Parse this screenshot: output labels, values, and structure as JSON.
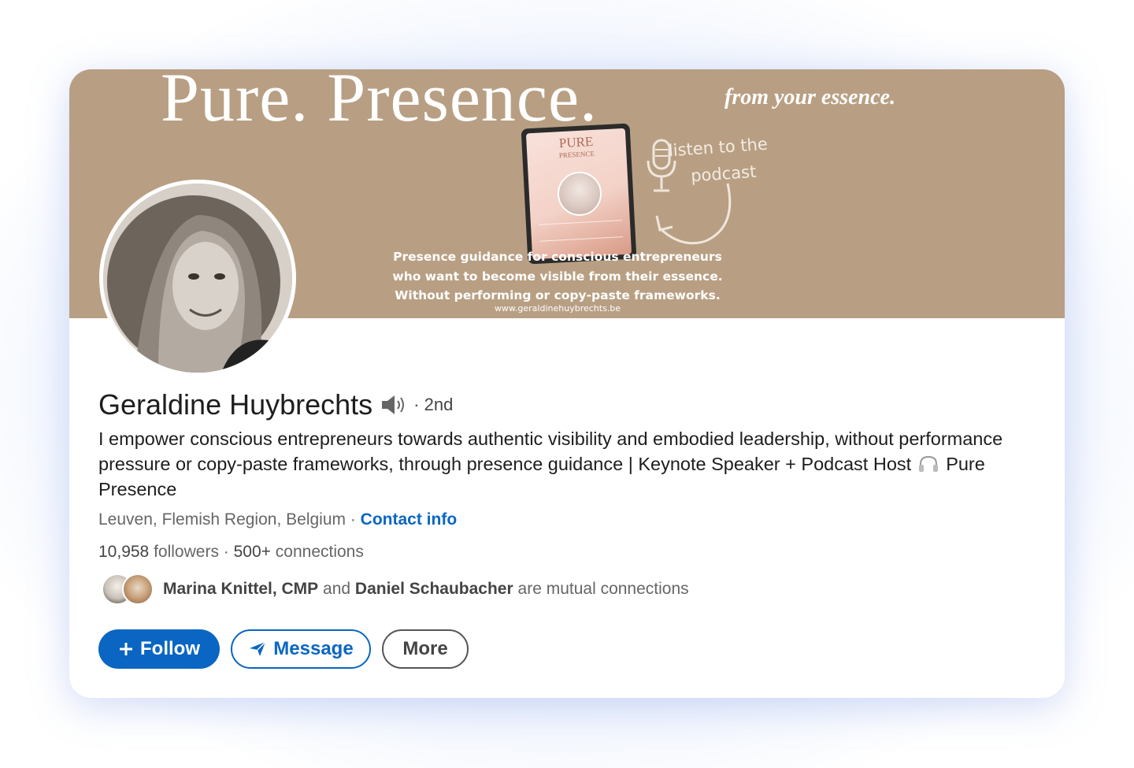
{
  "banner": {
    "headline": "Pure. Presence.",
    "tagline": "from your essence.",
    "tablet_title": "PURE",
    "tablet_subtitle": "PRESENCE",
    "podcast_line1": "listen to the",
    "podcast_line2": "podcast",
    "description_lines": [
      "Presence guidance for conscious entrepreneurs",
      "who want to become visible from their essence.",
      "Without performing or copy-paste frameworks."
    ],
    "url": "www.geraldinehuybrechts.be",
    "background_color": "#b89f83"
  },
  "profile": {
    "name": "Geraldine Huybrechts",
    "name_icon": "speaker-icon",
    "degree": "· 2nd",
    "headline_part1": "I empower conscious entrepreneurs towards authentic visibility and embodied leadership, without performance pressure or copy-paste frameworks, through presence guidance | Keynote Speaker + Podcast Host",
    "headline_icon": "headphones-icon",
    "headline_part2": "Pure Presence",
    "location": "Leuven, Flemish Region, Belgium",
    "location_separator": " · ",
    "contact_info": "Contact info",
    "followers_count": "10,958",
    "followers_label": "followers",
    "stats_separator": " · ",
    "connections_count": "500+",
    "connections_label": "connections",
    "mutual_name1": "Marina Knittel, CMP",
    "mutual_and": "and",
    "mutual_name2": "Daniel Schaubacher",
    "mutual_suffix": "are mutual connections"
  },
  "actions": {
    "follow_icon": "plus-icon",
    "follow_label": "Follow",
    "message_icon": "send-icon",
    "message_label": "Message",
    "more_label": "More"
  },
  "colors": {
    "accent": "#0a66c2",
    "text": "#1d1d1d",
    "muted": "#666666"
  }
}
